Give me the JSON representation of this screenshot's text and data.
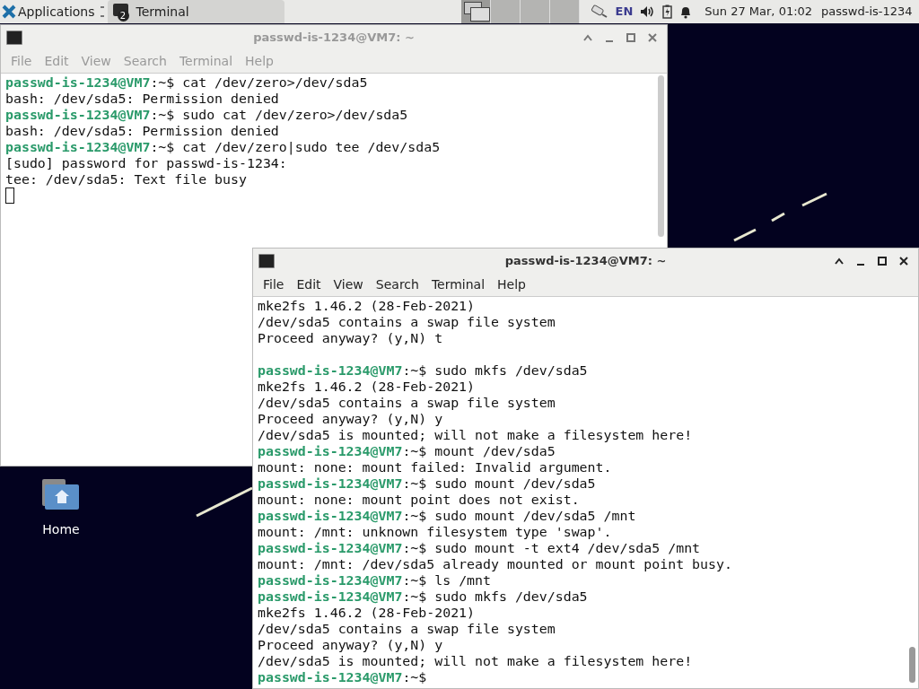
{
  "panel": {
    "applications": "Applications",
    "tasks": [
      {
        "label": "Terminal",
        "count": "2",
        "selected": true
      }
    ],
    "workspaces": [
      {
        "selected": true
      },
      {
        "selected": false
      },
      {
        "selected": false
      },
      {
        "selected": false
      }
    ],
    "keyboard": "EN",
    "clock": "Sun 27 Mar, 01:02",
    "user": "passwd-is-1234"
  },
  "desktop_icons": [
    {
      "label": "Home"
    }
  ],
  "windows": [
    {
      "title": "passwd-is-1234@VM7: ~",
      "active": false,
      "menu": [
        "File",
        "Edit",
        "View",
        "Search",
        "Terminal",
        "Help"
      ],
      "cursor": true,
      "lines": [
        {
          "kind": "prompt",
          "prompt": "passwd-is-1234@VM7",
          "command": ":~$ cat /dev/zero>/dev/sda5"
        },
        {
          "kind": "output",
          "text": "bash: /dev/sda5: Permission denied"
        },
        {
          "kind": "prompt",
          "prompt": "passwd-is-1234@VM7",
          "command": ":~$ sudo cat /dev/zero>/dev/sda5"
        },
        {
          "kind": "output",
          "text": "bash: /dev/sda5: Permission denied"
        },
        {
          "kind": "prompt",
          "prompt": "passwd-is-1234@VM7",
          "command": ":~$ cat /dev/zero|sudo tee /dev/sda5"
        },
        {
          "kind": "output",
          "text": "[sudo] password for passwd-is-1234:"
        },
        {
          "kind": "output",
          "text": "tee: /dev/sda5: Text file busy"
        }
      ]
    },
    {
      "title": "passwd-is-1234@VM7: ~",
      "active": true,
      "menu": [
        "File",
        "Edit",
        "View",
        "Search",
        "Terminal",
        "Help"
      ],
      "cursor": false,
      "lines": [
        {
          "kind": "output",
          "text": "mke2fs 1.46.2 (28-Feb-2021)"
        },
        {
          "kind": "output",
          "text": "/dev/sda5 contains a swap file system"
        },
        {
          "kind": "output",
          "text": "Proceed anyway? (y,N) t"
        },
        {
          "kind": "blank"
        },
        {
          "kind": "prompt",
          "prompt": "passwd-is-1234@VM7",
          "command": ":~$ sudo mkfs /dev/sda5"
        },
        {
          "kind": "output",
          "text": "mke2fs 1.46.2 (28-Feb-2021)"
        },
        {
          "kind": "output",
          "text": "/dev/sda5 contains a swap file system"
        },
        {
          "kind": "output",
          "text": "Proceed anyway? (y,N) y"
        },
        {
          "kind": "output",
          "text": "/dev/sda5 is mounted; will not make a filesystem here!"
        },
        {
          "kind": "prompt",
          "prompt": "passwd-is-1234@VM7",
          "command": ":~$ mount /dev/sda5"
        },
        {
          "kind": "output",
          "text": "mount: none: mount failed: Invalid argument."
        },
        {
          "kind": "prompt",
          "prompt": "passwd-is-1234@VM7",
          "command": ":~$ sudo mount /dev/sda5"
        },
        {
          "kind": "output",
          "text": "mount: none: mount point does not exist."
        },
        {
          "kind": "prompt",
          "prompt": "passwd-is-1234@VM7",
          "command": ":~$ sudo mount /dev/sda5 /mnt"
        },
        {
          "kind": "output",
          "text": "mount: /mnt: unknown filesystem type 'swap'."
        },
        {
          "kind": "prompt",
          "prompt": "passwd-is-1234@VM7",
          "command": ":~$ sudo mount -t ext4 /dev/sda5 /mnt"
        },
        {
          "kind": "output",
          "text": "mount: /mnt: /dev/sda5 already mounted or mount point busy."
        },
        {
          "kind": "prompt",
          "prompt": "passwd-is-1234@VM7",
          "command": ":~$ ls /mnt"
        },
        {
          "kind": "prompt",
          "prompt": "passwd-is-1234@VM7",
          "command": ":~$ sudo mkfs /dev/sda5"
        },
        {
          "kind": "output",
          "text": "mke2fs 1.46.2 (28-Feb-2021)"
        },
        {
          "kind": "output",
          "text": "/dev/sda5 contains a swap file system"
        },
        {
          "kind": "output",
          "text": "Proceed anyway? (y,N) y"
        },
        {
          "kind": "output",
          "text": "/dev/sda5 is mounted; will not make a filesystem here!"
        },
        {
          "kind": "prompt",
          "prompt": "passwd-is-1234@VM7",
          "command": ":~$"
        }
      ]
    }
  ]
}
